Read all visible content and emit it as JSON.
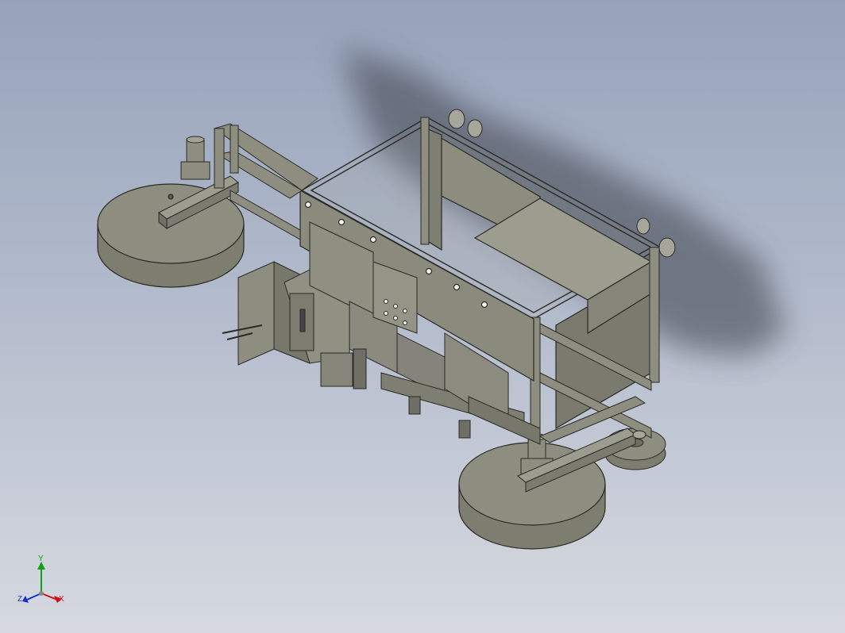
{
  "viewport": {
    "background_top": "#97a2ba",
    "background_bottom": "#d6d9e0",
    "model_color": "#8e8e80",
    "edge_color": "#2a2a26"
  },
  "triad": {
    "x_label": "X",
    "y_label": "Y",
    "z_label": "Z",
    "x_color": "#d01010",
    "y_color": "#10a010",
    "z_color": "#1030d0"
  }
}
